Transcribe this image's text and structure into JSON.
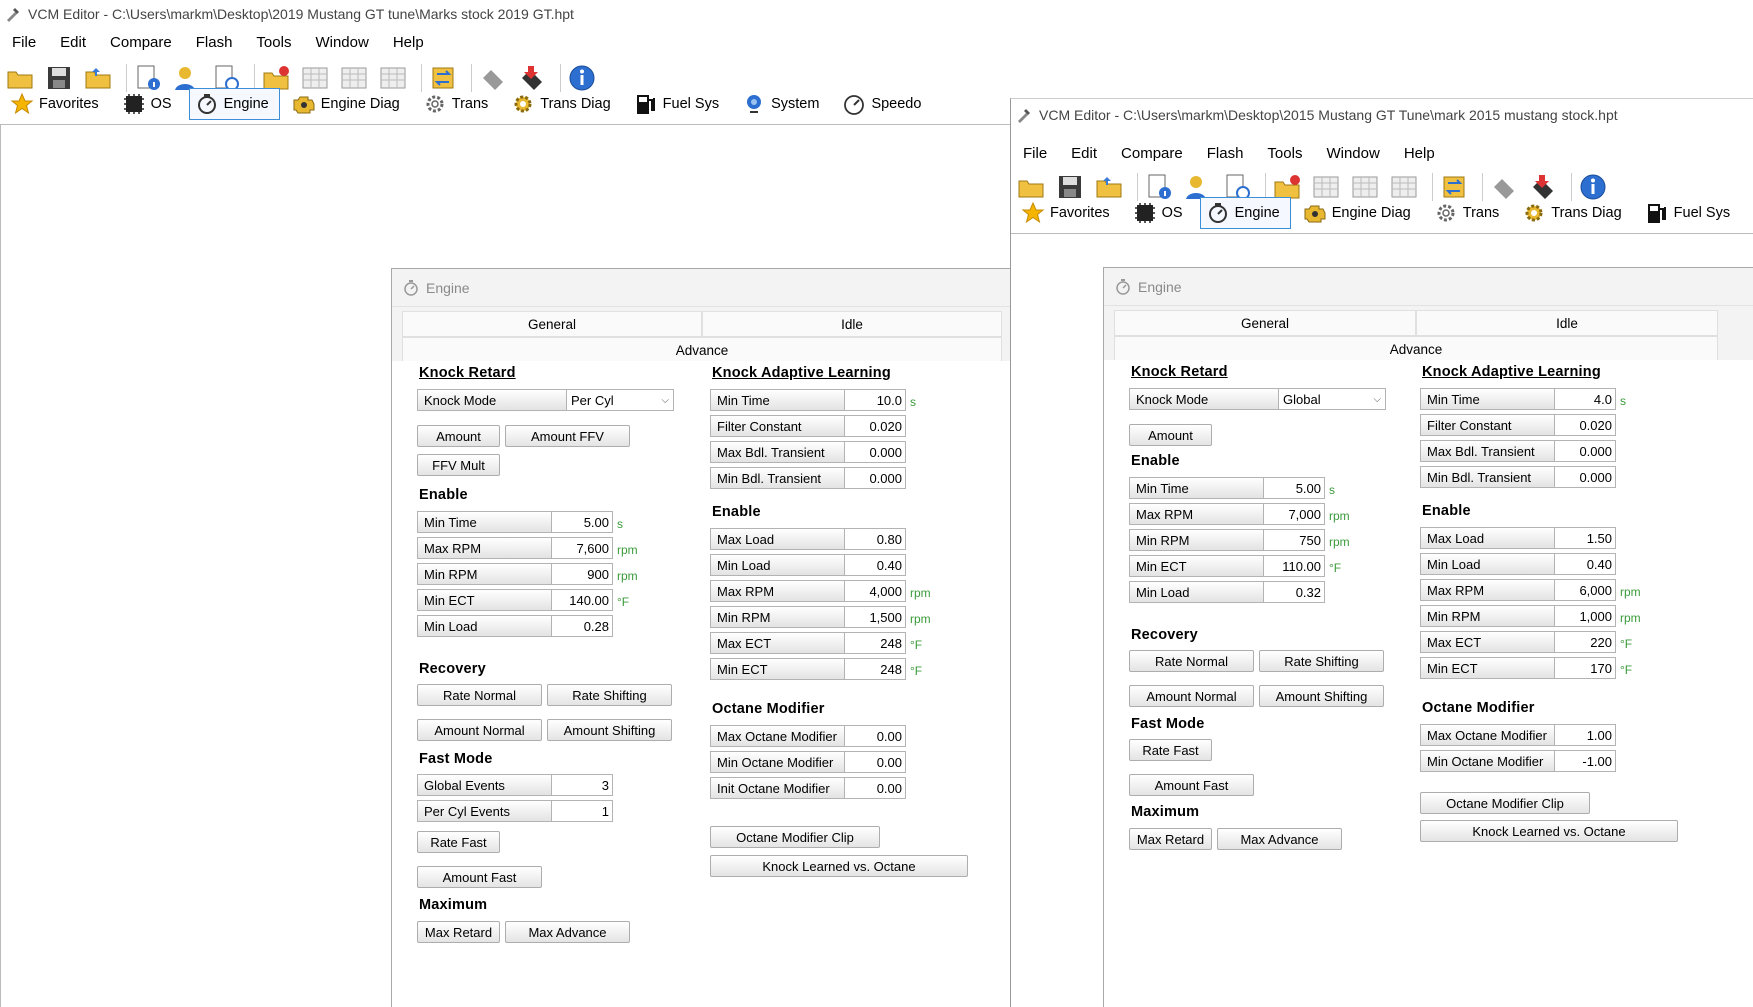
{
  "menu": [
    "File",
    "Edit",
    "Compare",
    "Flash",
    "Tools",
    "Window",
    "Help"
  ],
  "win1": {
    "title": "VCM Editor - C:\\Users\\markm\\Desktop\\2019 Mustang GT tune\\Marks stock 2019 GT.hpt",
    "tabs": [
      "Favorites",
      "OS",
      "Engine",
      "Engine Diag",
      "Trans",
      "Trans Diag",
      "Fuel Sys",
      "System",
      "Speedo"
    ],
    "panel": {
      "title": "Engine",
      "subtabs": {
        "general": "General",
        "idle": "Idle",
        "advance": "Advance"
      },
      "knock_retard": {
        "heading": "Knock Retard",
        "knock_mode_label": "Knock Mode",
        "knock_mode_value": "Per Cyl",
        "buttons": {
          "amount": "Amount",
          "amount_ffv": "Amount FFV",
          "ffv_mult": "FFV Mult"
        }
      },
      "enable": {
        "heading": "Enable",
        "rows": [
          {
            "label": "Min Time",
            "value": "5.00",
            "unit": "s"
          },
          {
            "label": "Max RPM",
            "value": "7,600",
            "unit": "rpm"
          },
          {
            "label": "Min RPM",
            "value": "900",
            "unit": "rpm"
          },
          {
            "label": "Min ECT",
            "value": "140.00",
            "unit": "°F"
          },
          {
            "label": "Min Load",
            "value": "0.28",
            "unit": ""
          }
        ]
      },
      "recovery": {
        "heading": "Recovery",
        "rate_normal": "Rate Normal",
        "rate_shifting": "Rate Shifting",
        "amount_normal": "Amount Normal",
        "amount_shifting": "Amount Shifting"
      },
      "fast_mode": {
        "heading": "Fast Mode",
        "rows": [
          {
            "label": "Global Events",
            "value": "3",
            "unit": ""
          },
          {
            "label": "Per Cyl Events",
            "value": "1",
            "unit": ""
          }
        ],
        "rate_fast": "Rate Fast",
        "amount_fast": "Amount Fast"
      },
      "maximum": {
        "heading": "Maximum",
        "max_retard": "Max Retard",
        "max_advance": "Max Advance"
      },
      "kal": {
        "heading": "Knock Adaptive Learning",
        "rows": [
          {
            "label": "Min Time",
            "value": "10.0",
            "unit": "s"
          },
          {
            "label": "Filter Constant",
            "value": "0.020",
            "unit": ""
          },
          {
            "label": "Max Bdl. Transient",
            "value": "0.000",
            "unit": ""
          },
          {
            "label": "Min Bdl. Transient",
            "value": "0.000",
            "unit": ""
          }
        ]
      },
      "kal_enable": {
        "heading": "Enable",
        "rows": [
          {
            "label": "Max Load",
            "value": "0.80",
            "unit": ""
          },
          {
            "label": "Min Load",
            "value": "0.40",
            "unit": ""
          },
          {
            "label": "Max RPM",
            "value": "4,000",
            "unit": "rpm"
          },
          {
            "label": "Min RPM",
            "value": "1,500",
            "unit": "rpm"
          },
          {
            "label": "Max ECT",
            "value": "248",
            "unit": "°F"
          },
          {
            "label": "Min ECT",
            "value": "248",
            "unit": "°F"
          }
        ]
      },
      "octane": {
        "heading": "Octane Modifier",
        "rows": [
          {
            "label": "Max Octane Modifier",
            "value": "0.00",
            "unit": ""
          },
          {
            "label": "Min Octane Modifier",
            "value": "0.00",
            "unit": ""
          },
          {
            "label": "Init Octane Modifier",
            "value": "0.00",
            "unit": ""
          }
        ],
        "clip": "Octane Modifier Clip",
        "klo": "Knock Learned vs. Octane"
      }
    }
  },
  "win2": {
    "title": "VCM Editor - C:\\Users\\markm\\Desktop\\2015 Mustang GT Tune\\mark 2015 mustang stock.hpt",
    "tabs": [
      "Favorites",
      "OS",
      "Engine",
      "Engine Diag",
      "Trans",
      "Trans Diag",
      "Fuel Sys"
    ],
    "panel": {
      "title": "Engine",
      "subtabs": {
        "general": "General",
        "idle": "Idle",
        "advance": "Advance"
      },
      "knock_retard": {
        "heading": "Knock Retard",
        "knock_mode_label": "Knock Mode",
        "knock_mode_value": "Global",
        "buttons": {
          "amount": "Amount"
        }
      },
      "enable": {
        "heading": "Enable",
        "rows": [
          {
            "label": "Min Time",
            "value": "5.00",
            "unit": "s"
          },
          {
            "label": "Max RPM",
            "value": "7,000",
            "unit": "rpm"
          },
          {
            "label": "Min RPM",
            "value": "750",
            "unit": "rpm"
          },
          {
            "label": "Min ECT",
            "value": "110.00",
            "unit": "°F"
          },
          {
            "label": "Min Load",
            "value": "0.32",
            "unit": ""
          }
        ]
      },
      "recovery": {
        "heading": "Recovery",
        "rate_normal": "Rate Normal",
        "rate_shifting": "Rate Shifting",
        "amount_normal": "Amount Normal",
        "amount_shifting": "Amount Shifting"
      },
      "fast_mode": {
        "heading": "Fast Mode",
        "rate_fast": "Rate Fast",
        "amount_fast": "Amount Fast"
      },
      "maximum": {
        "heading": "Maximum",
        "max_retard": "Max Retard",
        "max_advance": "Max Advance"
      },
      "kal": {
        "heading": "Knock Adaptive Learning",
        "rows": [
          {
            "label": "Min Time",
            "value": "4.0",
            "unit": "s"
          },
          {
            "label": "Filter Constant",
            "value": "0.020",
            "unit": ""
          },
          {
            "label": "Max Bdl. Transient",
            "value": "0.000",
            "unit": ""
          },
          {
            "label": "Min Bdl. Transient",
            "value": "0.000",
            "unit": ""
          }
        ]
      },
      "kal_enable": {
        "heading": "Enable",
        "rows": [
          {
            "label": "Max Load",
            "value": "1.50",
            "unit": ""
          },
          {
            "label": "Min Load",
            "value": "0.40",
            "unit": ""
          },
          {
            "label": "Max RPM",
            "value": "6,000",
            "unit": "rpm"
          },
          {
            "label": "Min RPM",
            "value": "1,000",
            "unit": "rpm"
          },
          {
            "label": "Max ECT",
            "value": "220",
            "unit": "°F"
          },
          {
            "label": "Min ECT",
            "value": "170",
            "unit": "°F"
          }
        ]
      },
      "octane": {
        "heading": "Octane Modifier",
        "rows": [
          {
            "label": "Max Octane Modifier",
            "value": "1.00",
            "unit": ""
          },
          {
            "label": "Min Octane Modifier",
            "value": "-1.00",
            "unit": ""
          }
        ],
        "clip": "Octane Modifier Clip",
        "klo": "Knock Learned vs. Octane"
      }
    }
  },
  "colors": {
    "accent": "#3c8ed6",
    "unit": "#3a9b3a",
    "star": "#f4b400"
  }
}
